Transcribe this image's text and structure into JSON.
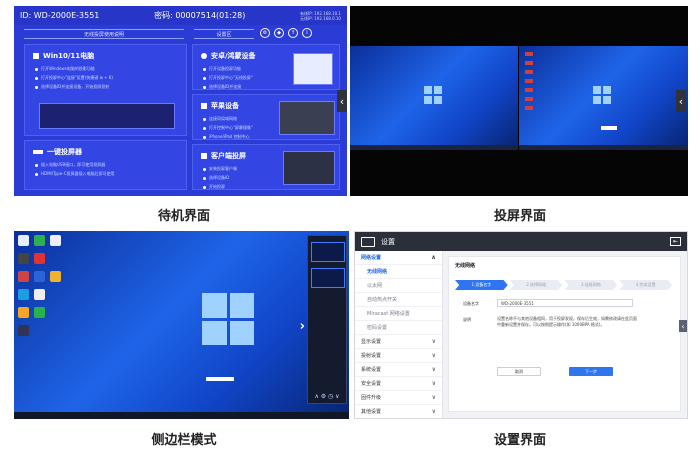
{
  "captions": {
    "standby": "待机界面",
    "casting": "投屏界面",
    "sidebar": "侧边栏模式",
    "settings": "设置界面"
  },
  "standby": {
    "id_text": "ID: WD-2000E-3551",
    "password_text": "密码: 00007514(01:28)",
    "ip_line1": "有线IP: 192.168.10.1",
    "ip_line2": "无线IP: 192.168.0.10",
    "banner_left": "无线投屏使用说明",
    "banner_right": "设置区",
    "cards": {
      "win": {
        "title": "Win10/11电脑",
        "items": [
          "打开Windows电脑的投影功能",
          "打开投屏中心\"连接\"设置(快捷键 ⊞ + K)",
          "选择设备ID并连接设备，开始投屏投射"
        ]
      },
      "android": {
        "title": "安卓/鸿蒙设备",
        "items": [
          "打开设备投屏功能",
          "打开投屏中心\"无线投屏\"",
          "选择设备ID并连接"
        ]
      },
      "apple": {
        "title": "苹果设备",
        "items": [
          "连接同局域网络",
          "打开控制中心\"屏幕镜像\"",
          "iPhone/iPad 控制中心"
        ]
      },
      "usb": {
        "title": "一键投屏器",
        "items": [
          "插入电脑USB接口，即可使用投屏器",
          "HDMI/Type-C投屏器插入电脑后即可使用"
        ]
      },
      "client": {
        "title": "客户端投屏",
        "items": [
          "安装投屏客户端",
          "选择设备ID",
          "开始投屏"
        ]
      }
    }
  },
  "sidebar_mode": {
    "arrow": "›",
    "bottom_icons": "∧ ⚙ ◷ ∨"
  },
  "settings": {
    "title": "设置",
    "nav": [
      {
        "label": "网络设置",
        "kind": "section",
        "selected": true,
        "chev": "∧"
      },
      {
        "label": "无线网络",
        "kind": "sub",
        "selected": true
      },
      {
        "label": "以太网",
        "kind": "sub"
      },
      {
        "label": "自动热点开关",
        "kind": "sub"
      },
      {
        "label": "Miracast 网络设置",
        "kind": "sub"
      },
      {
        "label": "密码设置",
        "kind": "sub"
      },
      {
        "label": "显示设置",
        "kind": "section",
        "chev": "∨"
      },
      {
        "label": "投射设置",
        "kind": "section",
        "chev": "∨"
      },
      {
        "label": "系统设置",
        "kind": "section",
        "chev": "∨"
      },
      {
        "label": "安全设置",
        "kind": "section",
        "chev": "∨"
      },
      {
        "label": "固件升级",
        "kind": "section",
        "chev": "∨"
      },
      {
        "label": "其他设置",
        "kind": "section",
        "chev": "∨"
      }
    ],
    "content_title": "无线网络",
    "steps": [
      "1.设备名字",
      "2.选择网络",
      "3.连接网络",
      "4.完成设置"
    ],
    "device_name_label": "设备名字",
    "device_name_value": "WD-2000E-3551",
    "desc_label": "说明",
    "desc_text": "设置名称不与其他设备相同，用于投屏发现。保存后生效，如需修改请在此页面中重新设置并保存。可以按照提示操作(如 1000BPA 格式)。",
    "cancel": "取消",
    "next": "下一步"
  }
}
